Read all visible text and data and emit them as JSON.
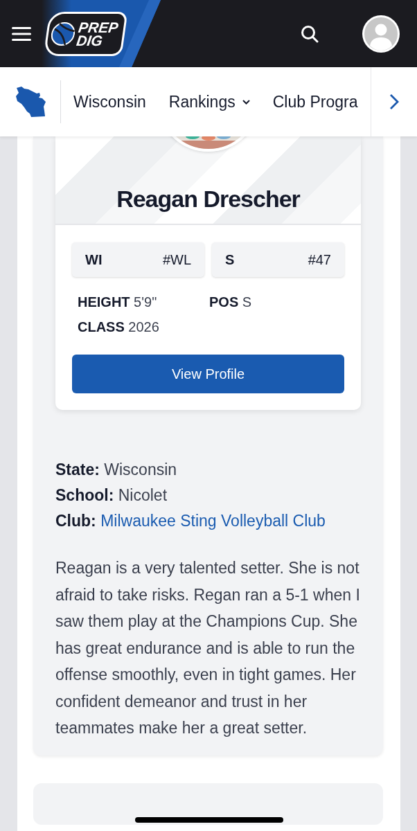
{
  "header": {
    "logo": {
      "line_1": "PREP",
      "line_2": "DIG"
    }
  },
  "state_nav": {
    "items": [
      {
        "label": "Wisconsin",
        "dropdown": false
      },
      {
        "label": "Rankings",
        "dropdown": true
      },
      {
        "label": "Club Progra",
        "dropdown": false
      }
    ]
  },
  "player_card": {
    "name": "Reagan Drescher",
    "badges": [
      {
        "label": "WI",
        "rank": "#WL"
      },
      {
        "label": "S",
        "rank": "#47"
      }
    ],
    "attributes": [
      {
        "label": "HEIGHT",
        "value": "5'9\""
      },
      {
        "label": "POS",
        "value": "S"
      },
      {
        "label": "CLASS",
        "value": "2026"
      }
    ],
    "button": "View Profile"
  },
  "details": [
    {
      "label": "State:",
      "value": "Wisconsin",
      "kind": "text"
    },
    {
      "label": "School:",
      "value": "Nicolet",
      "kind": "text"
    },
    {
      "label": "Club:",
      "value": "Milwaukee Sting Volleyball Club",
      "kind": "link"
    }
  ],
  "bio": "Reagan is a very talented setter. She is not afraid to take risks. Regan ran a 5-1 when I saw them play at the Champions Cup. She has great endurance and is able to run the offense smoothly, even in tight games. Her confident demeanor and trust in her teammates make her a great setter."
}
